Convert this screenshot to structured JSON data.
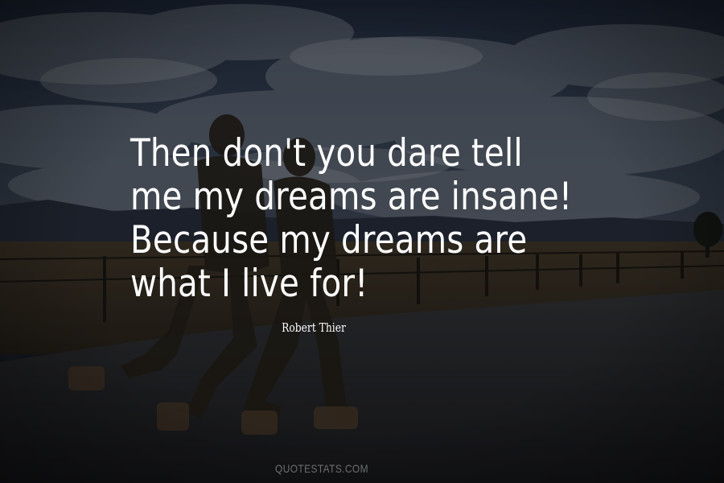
{
  "quote": {
    "lines": [
      "Then don't you dare tell",
      "me my dreams are insane!",
      "Because my dreams are",
      "what I live for!"
    ]
  },
  "author": "Robert Thier",
  "watermark": "QUOTESTATS.COM",
  "colors": {
    "sky": "#3a4a62",
    "road": "#2c2f33",
    "field": "#3a3226",
    "text": "#ffffff"
  }
}
